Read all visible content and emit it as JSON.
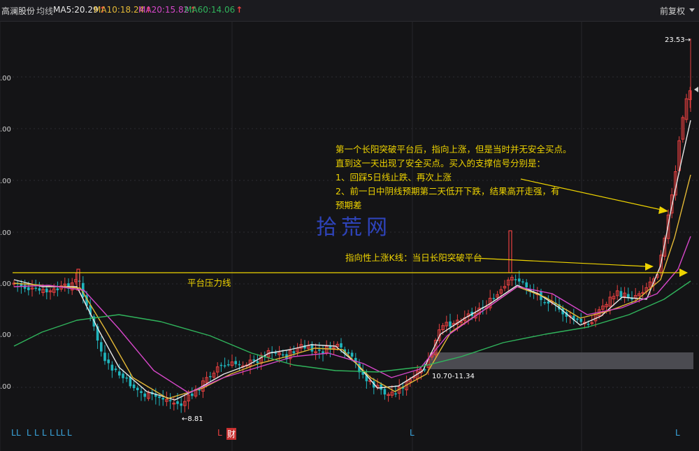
{
  "header": {
    "stock_name": "高澜股份",
    "avg_line_label": "均线",
    "ma5": "MA5:20.29",
    "ma10": "MA10:18.24",
    "ma20": "MA20:15.82",
    "ma60": "MA60:14.06",
    "up_arrow": "↑",
    "fq_label": "前复权"
  },
  "colors": {
    "background": "#141416",
    "up": "#e84040",
    "down": "#1fb5bd",
    "ma5": "#e8e8e8",
    "ma10": "#e3b836",
    "ma20": "#d647c9",
    "ma60": "#30b45c",
    "annotation": "#eed300",
    "watermark": "#3148c8"
  },
  "y_ticks": [
    ".00",
    ".00",
    ".00",
    ".00",
    ".00",
    ".00",
    ".00"
  ],
  "price_labels": {
    "high": "23.53→",
    "low": "←8.81",
    "zone": "10.70-11.34"
  },
  "annotations": {
    "main_text": [
      "第一个长阳突破平台后，指向上涨，但是当时并无安全买点。",
      "直到这一天出现了安全买点。买入的支撑信号分别是：",
      "1、回踩5日线止跌、再次上涨",
      "2、前一日中阴线预期第二天低开下跌，结果高开走强，有",
      "预期差"
    ],
    "breakout_text": "指向性上涨K线：当日长阳突破平台",
    "pressure_text": "平台压力线"
  },
  "watermark": "拾荒网",
  "bottom_markers": [
    "L",
    "L",
    "L",
    "L",
    "L",
    "LL",
    "L",
    "L",
    "L",
    "财",
    "L",
    "L"
  ]
}
